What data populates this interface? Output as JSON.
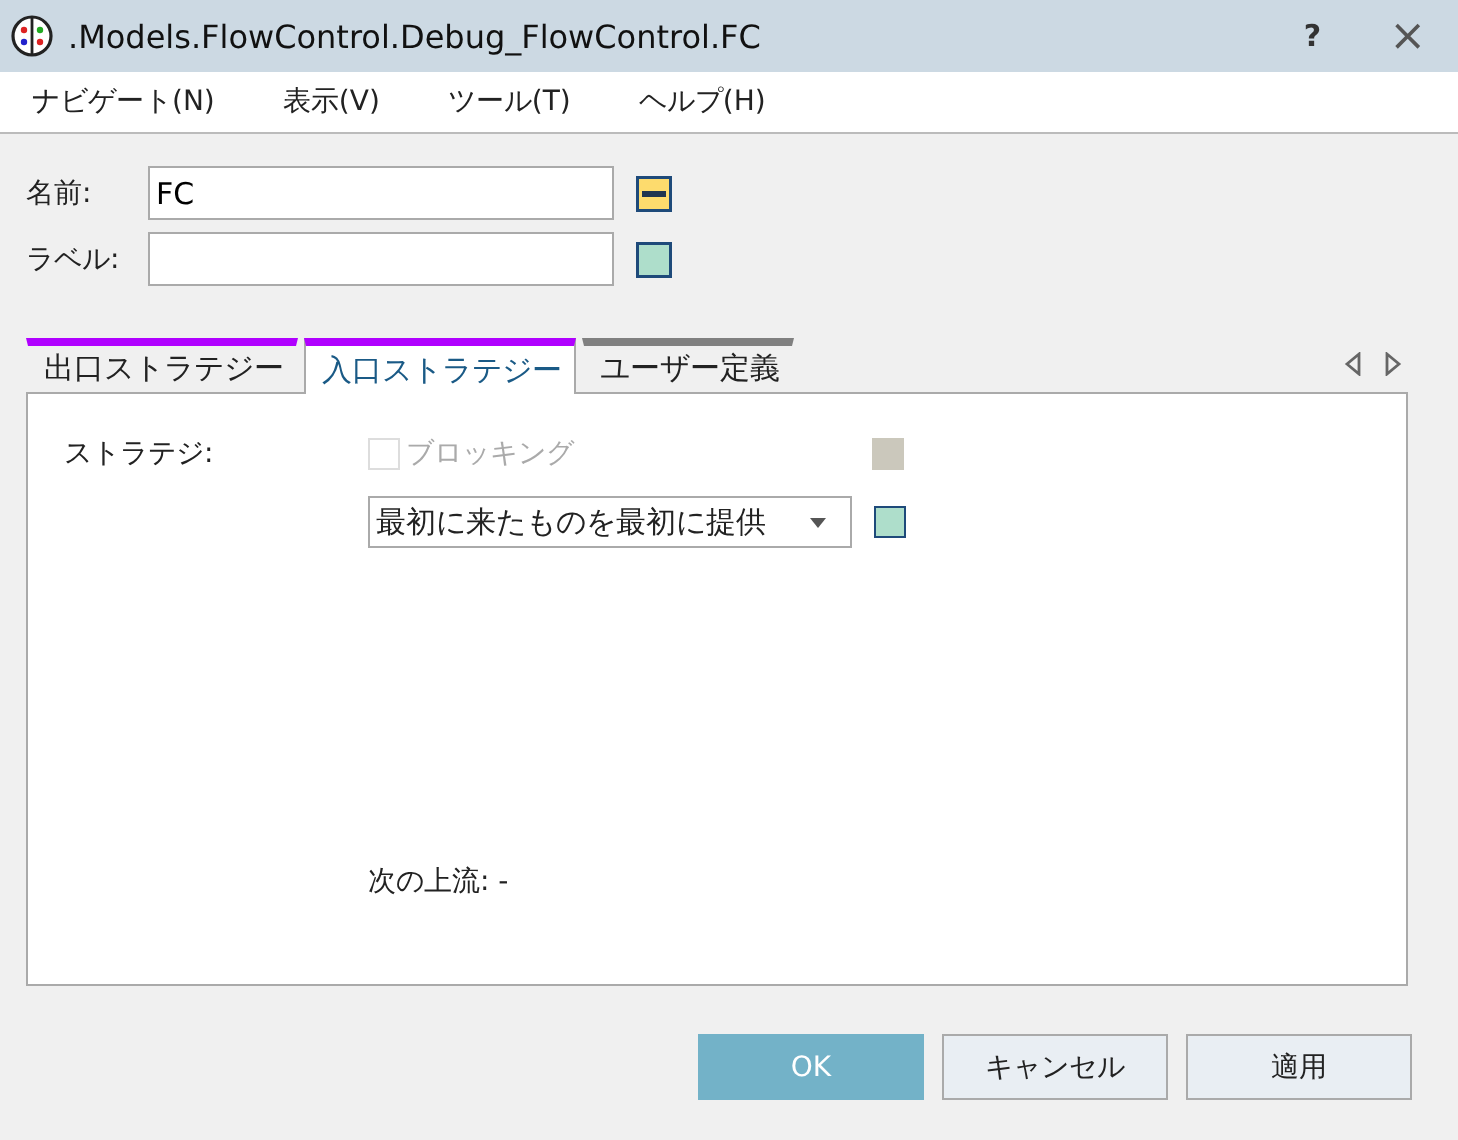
{
  "window": {
    "title": ".Models.FlowControl.Debug_FlowControl.FC",
    "help": "?",
    "close": "×"
  },
  "menu": [
    {
      "label": "ナビゲート(N)"
    },
    {
      "label": "表示(V)"
    },
    {
      "label": "ツール(T)"
    },
    {
      "label": "ヘルプ(H)"
    }
  ],
  "fields": [
    {
      "label": "名前:",
      "value": "FC",
      "indicator": {
        "kind": "dash",
        "color": "#fddb6d"
      }
    },
    {
      "label": "ラベル:",
      "indicator": {
        "kind": "plain",
        "color": "#aedecb"
      }
    }
  ],
  "tabs": [
    {
      "label": "出口ストラテジー",
      "selected": false,
      "color": "#b000ff"
    },
    {
      "label": "入口ストラテジー",
      "selected": true,
      "color": "#b000ff"
    },
    {
      "label": "ユーザー定義",
      "selected": false,
      "color": "#808080"
    }
  ],
  "strategy": {
    "label": "ストラテジ:",
    "checkbox": {
      "label": "ブロッキング",
      "checked": false,
      "disabled": true,
      "indicator": {
        "color": "#cbc8bc"
      }
    },
    "dropdown": {
      "value": "最初に来たものを最初に提供",
      "indicator": {
        "color": "#aedecb"
      }
    },
    "next_upstream": "次の上流: -"
  },
  "buttons": [
    {
      "label": "OK",
      "kind": "primary"
    },
    {
      "label": "キャンセル",
      "kind": "normal"
    },
    {
      "label": "適用",
      "kind": "normal"
    }
  ]
}
